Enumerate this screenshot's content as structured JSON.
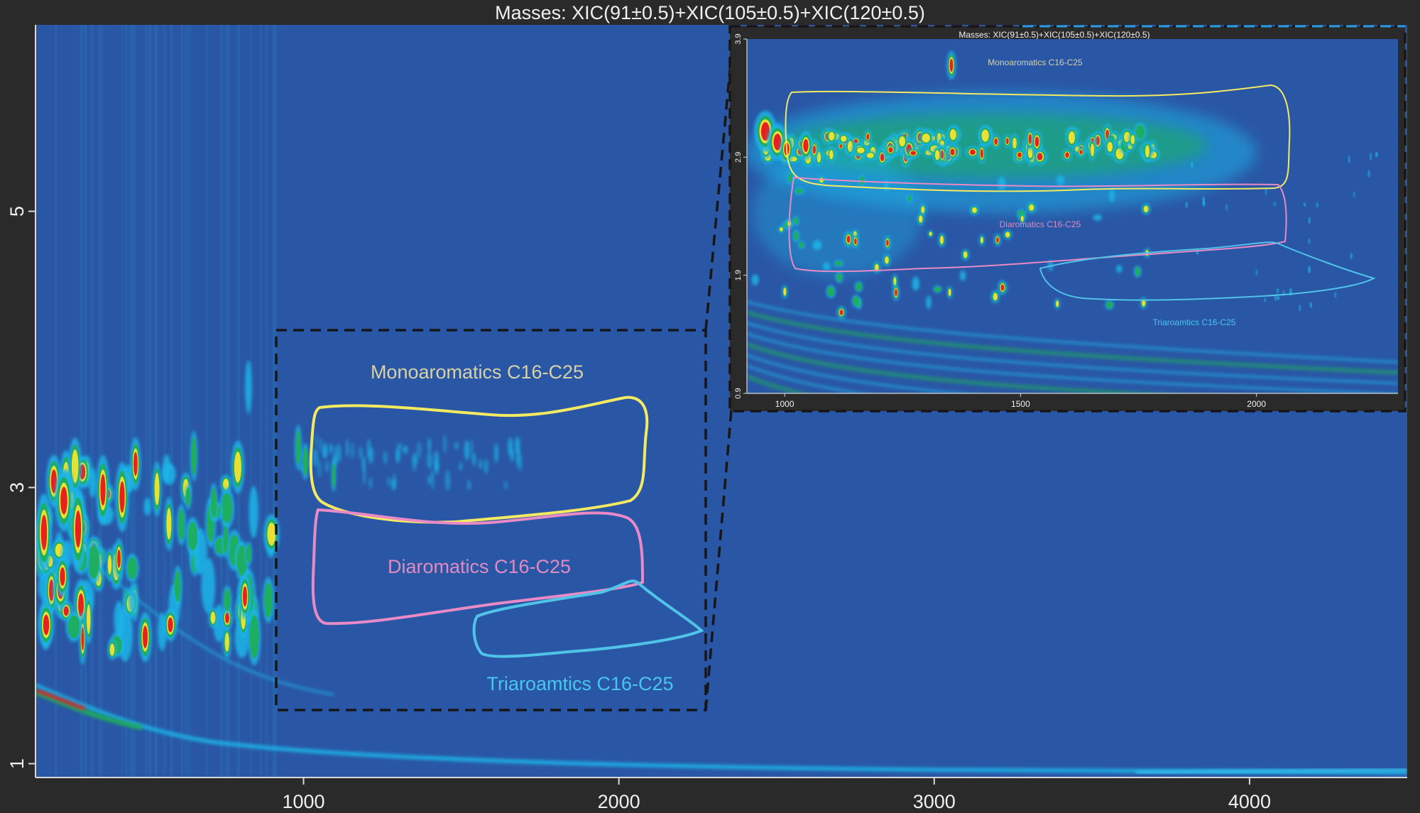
{
  "chart_data": {
    "type": "heatmap",
    "title": "Masses:  XIC(91±0.5)+XIC(105±0.5)+XIC(120±0.5)",
    "xlabel": "",
    "ylabel": "",
    "xlim": [
      150,
      4500
    ],
    "ylim": [
      0.9,
      6.35
    ],
    "x_ticks": [
      1000,
      2000,
      3000,
      4000
    ],
    "x_tick_labels": [
      "1000",
      "2000",
      "3000",
      "4000"
    ],
    "y_ticks": [
      1,
      3,
      5
    ],
    "y_tick_labels": [
      "1",
      "3",
      "5"
    ],
    "regions": [
      {
        "label": "Monoaromatics C16-C25",
        "color": "#f3ea62"
      },
      {
        "label": "Diaromatics C16-C25",
        "color": "#e98ac6"
      },
      {
        "label": "Triaroamtics C16-C25",
        "color": "#4fc3e8"
      }
    ],
    "inset": {
      "title": "Masses:  XIC(91±0.5)+XIC(105±0.5)+XIC(120±0.5)",
      "xlim": [
        920,
        2300
      ],
      "ylim": [
        0.9,
        3.9
      ],
      "x_ticks": [
        1000,
        1500,
        2000
      ],
      "x_tick_labels": [
        "1000",
        "1500",
        "2000"
      ],
      "y_ticks": [
        3.9,
        2.9,
        1.9,
        0.9
      ],
      "y_tick_labels": [
        "3.9",
        "2.9",
        "1.9",
        "0.9"
      ],
      "region_labels": [
        "Monoaromatics C16-C25",
        "Diaromatics C16-C25",
        "Triaroamtics C16-C25"
      ]
    },
    "colors": {
      "background": "#2a57a5",
      "frame": "#2a2a2a",
      "axis_text": "#f0f0f0",
      "zoom_box": "#1a1a1a",
      "heat_low": "#1fb5e8",
      "heat_mid": "#1fae5a",
      "heat_high": "#e8e034",
      "heat_peak": "#e82020"
    }
  }
}
